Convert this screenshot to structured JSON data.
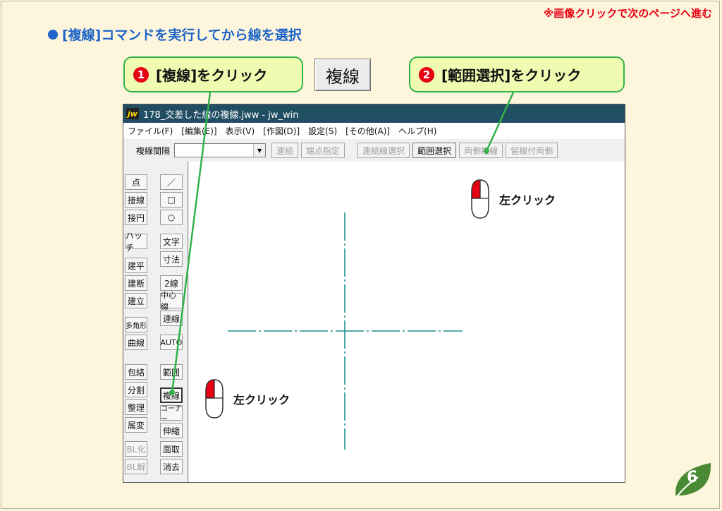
{
  "top_note": "※画像クリックで次のページへ進む",
  "heading": "[複線]コマンドを実行してから線を選択",
  "callouts": [
    {
      "number": "1",
      "text": "[複線]をクリック"
    },
    {
      "number": "2",
      "text": "[範囲選択]をクリック"
    }
  ],
  "big_button": "複線",
  "window": {
    "title": "178_交差した線の複線.jww - jw_win",
    "menu": [
      "ファイル(F)",
      "[編集(E)]",
      "表示(V)",
      "[作図(D)]",
      "設定(S)",
      "[その他(A)]",
      "ヘルプ(H)"
    ],
    "toolbar": {
      "label": "複線間隔",
      "input_value": "",
      "buttons": [
        "連続",
        "端点指定",
        "連続線選択",
        "範囲選択",
        "両側複線",
        "留線付両側"
      ],
      "active_button": "範囲選択"
    },
    "left_tools": [
      "点",
      "接線",
      "接円",
      "ハッチ",
      "建平",
      "建断",
      "建立",
      "多角形",
      "曲線",
      "包絡",
      "分割",
      "整理",
      "属変",
      "BL化",
      "BL解"
    ],
    "right_tools": [
      "／",
      "□",
      "○",
      "文字",
      "寸法",
      "2線",
      "中心線",
      "連線",
      "AUTO",
      "範囲",
      "複線",
      "コーナー",
      "伸縮",
      "面取",
      "消去"
    ]
  },
  "click_labels": [
    "左クリック",
    "左クリック"
  ],
  "page_number": "6",
  "colors": {
    "accent_blue": "#1f64c8",
    "note_red": "#e60012",
    "callout_bg": "#eefbb0",
    "callout_border": "#32b24a",
    "titlebar": "#214e63",
    "centerline": "#1e9490",
    "page_green": "#4a8a35"
  }
}
